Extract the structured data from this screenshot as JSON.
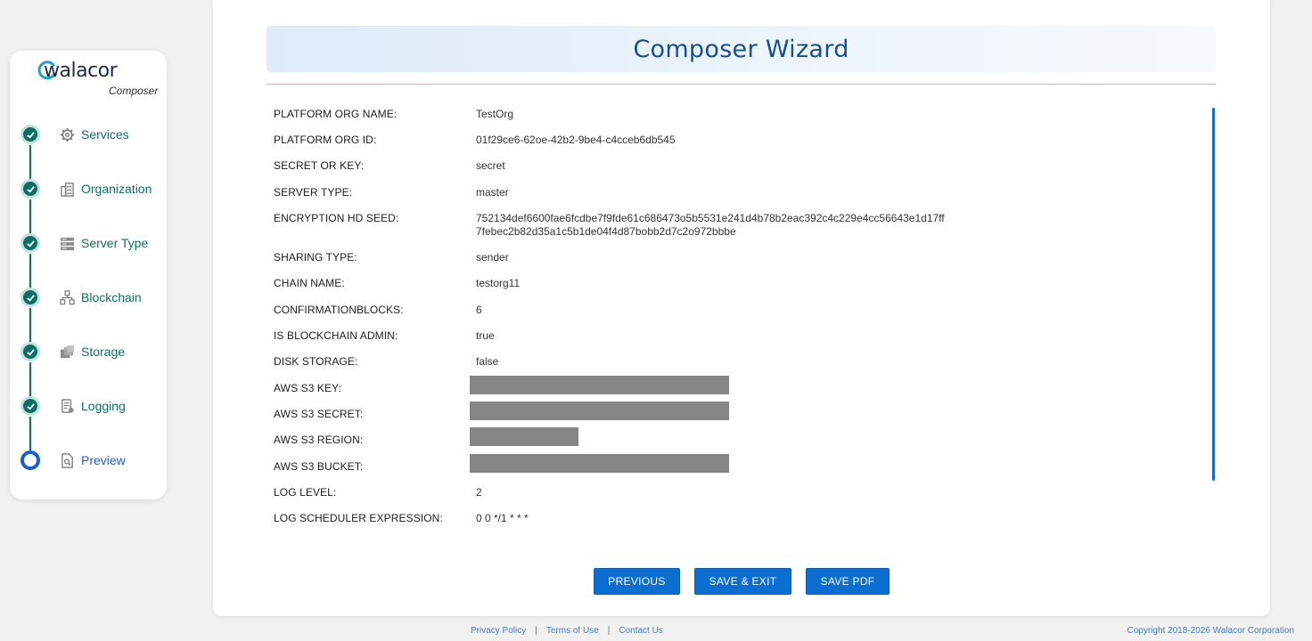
{
  "brand": {
    "name": "walacor",
    "subtitle": "Composer"
  },
  "steps": [
    {
      "label": "Services",
      "icon": "gear-icon",
      "status": "done"
    },
    {
      "label": "Organization",
      "icon": "building-icon",
      "status": "done"
    },
    {
      "label": "Server Type",
      "icon": "server-icon",
      "status": "done"
    },
    {
      "label": "Blockchain",
      "icon": "blockchain-icon",
      "status": "done"
    },
    {
      "label": "Storage",
      "icon": "storage-icon",
      "status": "done"
    },
    {
      "label": "Logging",
      "icon": "logging-icon",
      "status": "done"
    },
    {
      "label": "Preview",
      "icon": "preview-icon",
      "status": "active"
    }
  ],
  "main": {
    "title": "Composer Wizard",
    "fields": [
      {
        "key": "PLATFORM ORG NAME:",
        "value": "TestOrg"
      },
      {
        "key": "PLATFORM ORG ID:",
        "value": "01f29ce6-62oe-42b2-9be4-c4cceb6db545"
      },
      {
        "key": "SECRET OR KEY:",
        "value": "secret"
      },
      {
        "key": "SERVER TYPE:",
        "value": "master"
      },
      {
        "key": "ENCRYPTION HD SEED:",
        "value": "752134def6600fae6fcdbe7f9fde61c686473o5b5531e241d4b78b2eac392c4c229e4cc56643e1d17ff",
        "value2": "7febec2b82d35a1c5b1de04f4d87bobb2d7c2o972bbbe"
      },
      {
        "key": "SHARING TYPE:",
        "value": "sender"
      },
      {
        "key": "CHAIN NAME:",
        "value": "testorg11"
      },
      {
        "key": "CONFIRMATIONBLOCKS:",
        "value": "6"
      },
      {
        "key": "IS BLOCKCHAIN ADMIN:",
        "value": "true"
      },
      {
        "key": "DISK STORAGE:",
        "value": "false"
      },
      {
        "key": "AWS S3 KEY:",
        "value": "",
        "redacted": true
      },
      {
        "key": "AWS S3 SECRET:",
        "value": "",
        "redacted": true
      },
      {
        "key": "AWS S3 REGION:",
        "value": "",
        "redacted": true
      },
      {
        "key": "AWS S3 BUCKET:",
        "value": "",
        "redacted": true
      },
      {
        "key": "LOG LEVEL:",
        "value": "2"
      },
      {
        "key": "LOG SCHEDULER EXPRESSION:",
        "value": "0 0 */1 * * *"
      }
    ],
    "buttons": {
      "previous": "PREVIOUS",
      "save_exit": "SAVE & EXIT",
      "save_pdf": "SAVE PDF"
    }
  },
  "footer": {
    "privacy": "Privacy Policy",
    "terms": "Terms of Use",
    "contact": "Contact Us",
    "separator": "|",
    "copyright": "Copyright 2018-2026 Walacor Corporation"
  },
  "colors": {
    "step_done": "#0f6e63",
    "step_active": "#1a5fd0",
    "button": "#0b6fd1",
    "title": "#1a4f8f"
  }
}
